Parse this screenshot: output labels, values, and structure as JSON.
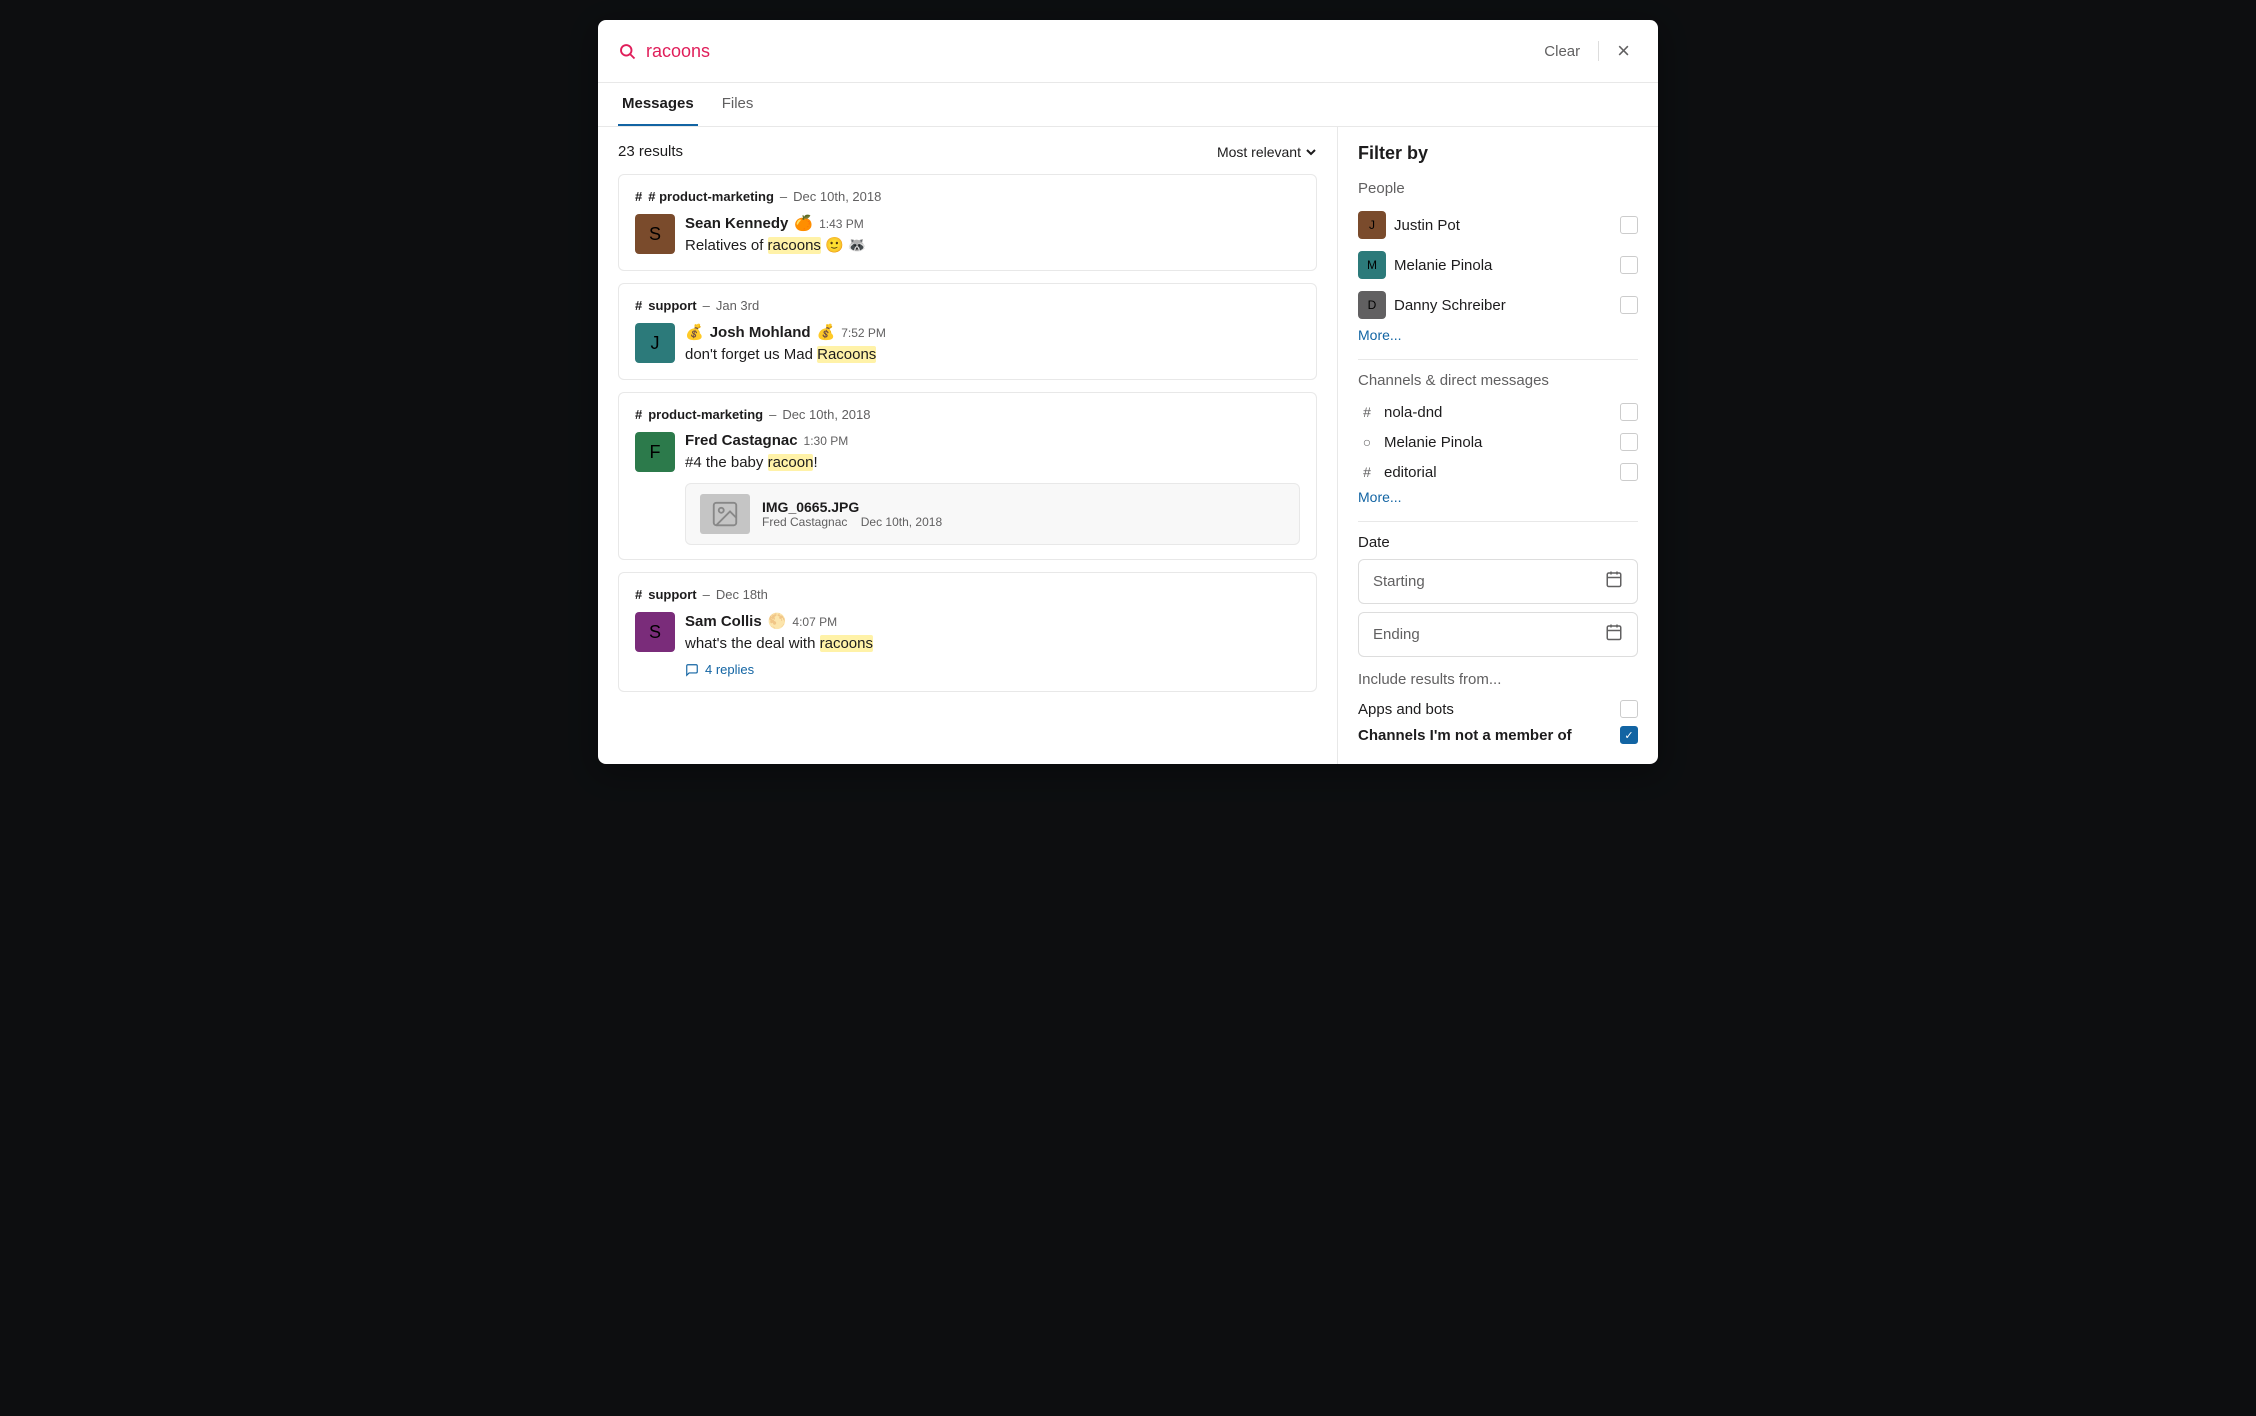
{
  "search": {
    "query": "racoons",
    "clear_label": "Clear",
    "close_label": "×"
  },
  "tabs": [
    {
      "label": "Messages",
      "active": true
    },
    {
      "label": "Files",
      "active": false
    }
  ],
  "results": {
    "count": "23 results",
    "sort_label": "Most relevant"
  },
  "messages": [
    {
      "channel": "# product-marketing",
      "date": "Dec 10th, 2018",
      "author": "Sean Kennedy",
      "author_emoji": "🍊",
      "time": "1:43 PM",
      "text_before": "Relatives of ",
      "highlight": "racoons",
      "text_after": " 🙂 🦝",
      "avatar_bg": "av-brown",
      "avatar_letter": "S"
    },
    {
      "channel": "# support",
      "date": "Jan 3rd",
      "author": "Josh Mohland",
      "author_emoji": "💰",
      "author_emoji2": "💰",
      "time": "7:52 PM",
      "text_before": "don't forget us Mad ",
      "highlight": "Racoons",
      "text_after": "",
      "avatar_bg": "av-teal",
      "avatar_letter": "J"
    },
    {
      "channel": "# product-marketing",
      "date": "Dec 10th, 2018",
      "author": "Fred Castagnac",
      "author_emoji": "",
      "time": "1:30 PM",
      "text_before": "#4 the baby ",
      "highlight": "racoon",
      "text_after": "!",
      "avatar_bg": "av-green",
      "avatar_letter": "F",
      "attachment": {
        "filename": "IMG_0665.JPG",
        "uploader": "Fred Castagnac",
        "upload_date": "Dec 10th, 2018"
      }
    },
    {
      "channel": "# support",
      "date": "Dec 18th",
      "author": "Sam Collis",
      "author_emoji": "🌕",
      "time": "4:07 PM",
      "text_before": "what's the deal with ",
      "highlight": "racoons",
      "text_after": "",
      "avatar_bg": "av-purple",
      "avatar_letter": "S",
      "replies": "4 replies"
    }
  ],
  "filter": {
    "title": "Filter by",
    "people_label": "People",
    "people": [
      {
        "name": "Justin Pot",
        "checked": false
      },
      {
        "name": "Melanie Pinola",
        "checked": false
      },
      {
        "name": "Danny Schreiber",
        "checked": false
      }
    ],
    "people_more": "More...",
    "channels_label": "Channels & direct messages",
    "channels": [
      {
        "name": "nola-dnd",
        "type": "hash",
        "checked": false
      },
      {
        "name": "Melanie Pinola",
        "type": "circle",
        "checked": false
      },
      {
        "name": "editorial",
        "type": "hash",
        "checked": false
      }
    ],
    "channels_more": "More...",
    "date_label": "Date",
    "starting_placeholder": "Starting",
    "ending_placeholder": "Ending",
    "include_label": "Include results from...",
    "include_items": [
      {
        "label": "Apps and bots",
        "checked": false,
        "bold": false
      },
      {
        "label": "Channels I'm not a member of",
        "checked": true,
        "bold": true
      }
    ]
  }
}
